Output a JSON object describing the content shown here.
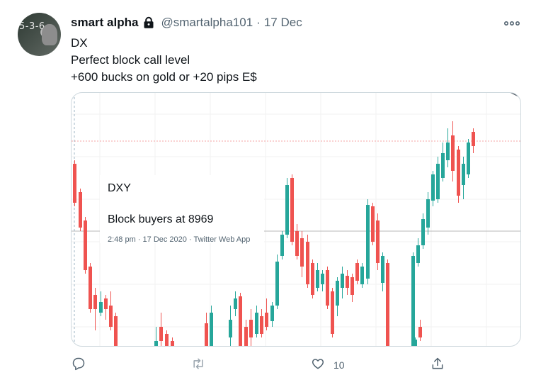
{
  "tweet": {
    "avatar_text": "5-3-6",
    "display_name": "smart alpha",
    "handle": "@smartalpha101",
    "separator": "·",
    "date": "17 Dec",
    "lines": [
      "DX",
      "Perfect block call level",
      "+600 bucks on gold or +20 pips E$"
    ]
  },
  "embedded_tweet": {
    "title": "DXY",
    "text": "Block buyers at 8969",
    "meta": "2:48 pm · 17 Dec 2020 · Twitter Web App"
  },
  "actions": {
    "reply_count": "",
    "retweet_count": "",
    "like_count": "10",
    "share_count": ""
  },
  "colors": {
    "up": "#26a69a",
    "down": "#ef5350",
    "muted": "#536471",
    "border": "#cfd9de"
  },
  "icons": [
    "lock-icon",
    "more-icon",
    "reply-icon",
    "retweet-icon",
    "like-icon",
    "share-icon"
  ]
}
